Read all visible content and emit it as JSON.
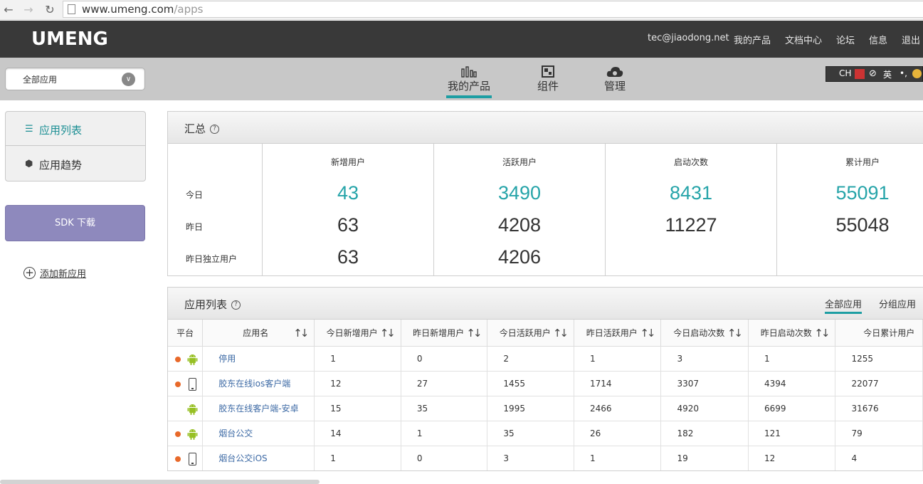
{
  "browser": {
    "url_host": "www.umeng.com",
    "url_path": "/apps"
  },
  "topbar": {
    "brand": "UMENG",
    "links": [
      "tec@jiaodong.net",
      "我的产品",
      "文档中心",
      "论坛",
      "信息",
      "退出"
    ]
  },
  "navbar": {
    "app_select": "全部应用",
    "tabs": [
      {
        "label": "我的产品",
        "active": true
      },
      {
        "label": "组件",
        "active": false
      },
      {
        "label": "管理",
        "active": false
      }
    ],
    "ime": {
      "lang": "CH",
      "mode": "英"
    }
  },
  "sidebar": {
    "items": [
      {
        "label": "应用列表",
        "active": true
      },
      {
        "label": "应用趋势",
        "active": false
      }
    ],
    "sdk_button": "SDK 下载",
    "add_app": "添加新应用"
  },
  "summary": {
    "title": "汇总",
    "row_labels": [
      "今日",
      "昨日",
      "昨日独立用户"
    ],
    "columns": [
      {
        "header": "新增用户",
        "today": "43",
        "yesterday": "63",
        "unique": "63"
      },
      {
        "header": "活跃用户",
        "today": "3490",
        "yesterday": "4208",
        "unique": "4206"
      },
      {
        "header": "启动次数",
        "today": "8431",
        "yesterday": "11227",
        "unique": ""
      },
      {
        "header": "累计用户",
        "today": "55091",
        "yesterday": "55048",
        "unique": ""
      }
    ]
  },
  "app_list": {
    "title": "应用列表",
    "tabs": [
      "全部应用",
      "分组应用"
    ],
    "headers": [
      "平台",
      "应用名",
      "今日新增用户",
      "昨日新增用户",
      "今日活跃用户",
      "昨日活跃用户",
      "今日启动次数",
      "昨日启动次数",
      "今日累计用户"
    ],
    "rows": [
      {
        "platform": "android",
        "dot": true,
        "name": "停用",
        "values": [
          "1",
          "0",
          "2",
          "1",
          "3",
          "1",
          "1255"
        ]
      },
      {
        "platform": "ios",
        "dot": true,
        "name": "胶东在线ios客户端",
        "values": [
          "12",
          "27",
          "1455",
          "1714",
          "3307",
          "4394",
          "22077"
        ]
      },
      {
        "platform": "android",
        "dot": false,
        "name": "胶东在线客户端-安卓",
        "values": [
          "15",
          "35",
          "1995",
          "2466",
          "4920",
          "6699",
          "31676"
        ]
      },
      {
        "platform": "android",
        "dot": true,
        "name": "烟台公交",
        "values": [
          "14",
          "1",
          "35",
          "26",
          "182",
          "121",
          "79"
        ]
      },
      {
        "platform": "ios",
        "dot": true,
        "name": "烟台公交iOS",
        "values": [
          "1",
          "0",
          "3",
          "1",
          "19",
          "12",
          "4"
        ]
      }
    ]
  },
  "colors": {
    "accent": "#26a4a9",
    "sdk_button": "#8e89bd",
    "status_dot": "#e8692a",
    "android": "#97c024"
  }
}
